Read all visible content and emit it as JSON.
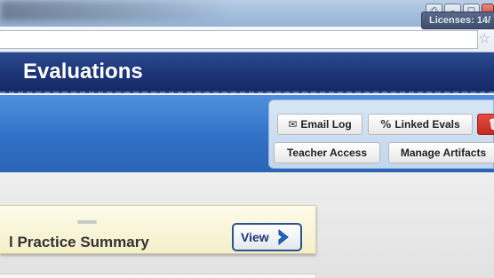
{
  "browser": {
    "window_controls": {
      "restore_glyph": "⎙",
      "minimize_glyph": "–",
      "maximize_glyph": "□",
      "close_glyph": ""
    },
    "bookmark_glyph": "☆"
  },
  "header": {
    "title": "Evaluations",
    "licenses": "Licenses: 14/"
  },
  "toolbar": {
    "email_log_label": "Email Log",
    "linked_evals_label": "Linked Evals",
    "teacher_access_label": "Teacher Access",
    "manage_artifacts_label": "Manage Artifacts",
    "email_icon": "✉",
    "linked_icon": "%",
    "delete_icon": "🗑"
  },
  "card": {
    "title": "l Practice Summary",
    "view_label": "View"
  },
  "colors": {
    "header_blue": "#1c3478",
    "toolbar_blue": "#2f6fc4",
    "delete_red": "#c22b22",
    "card_cream": "#f5efc9"
  }
}
